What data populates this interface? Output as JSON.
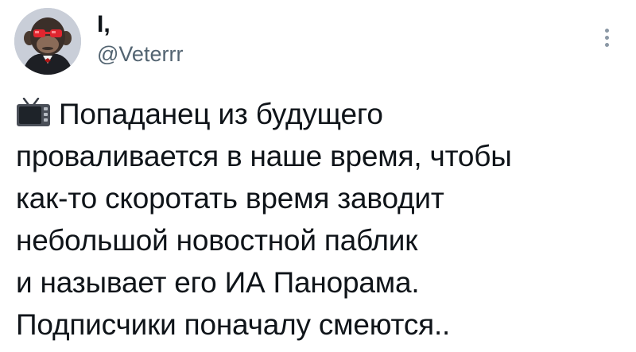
{
  "tweet": {
    "author": {
      "display_name": "I,",
      "handle": "@Veterrr",
      "avatar_icon": "monkey-sunglasses-avatar"
    },
    "more_icon": "more-vertical-icon",
    "emoji_icon": "television-icon",
    "text_lines": [
      "Попаданец из будущего",
      "проваливается в наше время, чтобы",
      "как-то скоротать время заводит",
      "небольшой новостной паблик",
      "и называет его ИА Панорама.",
      "Подписчики поначалу смеются.."
    ],
    "colors": {
      "text": "#0f1419",
      "secondary": "#536471",
      "more_dots": "#8b98a5"
    }
  }
}
